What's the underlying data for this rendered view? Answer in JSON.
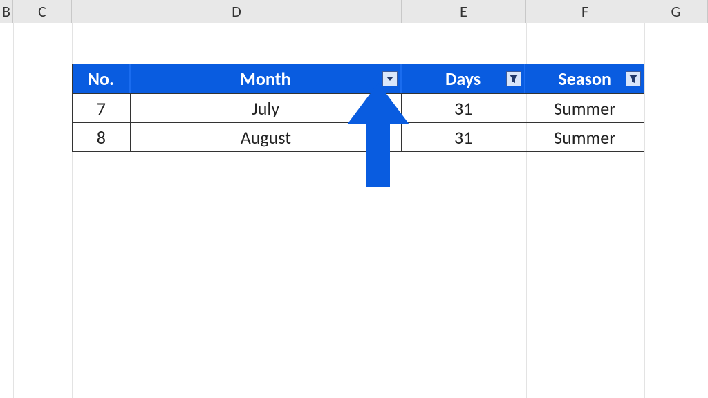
{
  "columns": {
    "B": "B",
    "C": "C",
    "D": "D",
    "E": "E",
    "F": "F",
    "G": "G"
  },
  "headers": {
    "no": "No.",
    "month": "Month",
    "days": "Days",
    "season": "Season"
  },
  "rows": [
    {
      "no": "7",
      "month": "July",
      "days": "31",
      "season": "Summer"
    },
    {
      "no": "8",
      "month": "August",
      "days": "31",
      "season": "Summer"
    }
  ],
  "annotation": {
    "type": "arrow",
    "color": "#095ce0"
  }
}
